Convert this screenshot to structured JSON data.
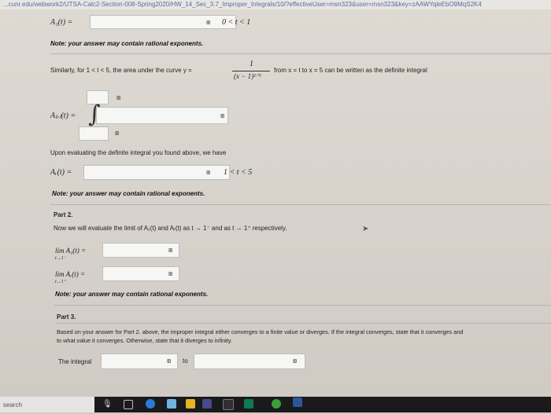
{
  "url": "...cunr.edu/webwork2/UTSA-Calc2-Section-008-Spring2020/HW_14_Sec_3.7_Improper_Integrals/10/?effectiveUser=msn323&user=msn323&key=zAAWYqleEbO9MqS2K4",
  "part1": {
    "a1_label": "A₁(t) =",
    "a1_cond": "0 < t < 1",
    "note1": "Note: your answer may contain rational exponents.",
    "similarly_pre": "Similarly, for 1 < t < 5, the area under the curve y =",
    "fraction_num": "1",
    "fraction_den": "(x − 1)²ᐟ³",
    "similarly_post": "from x = t to x = 5 can be written as the definite integral",
    "ar_label": "A₍ᵣ₎(t) =",
    "integral_sign": "∫",
    "evaluating_text": "Upon evaluating the definite integral you found above, we have",
    "ar_label2": "Aᵣ(t) =",
    "ar_cond": "1 < t < 5",
    "note2": "Note: your answer may contain rational exponents."
  },
  "part2": {
    "heading": "Part 2.",
    "intro": "Now we will evaluate the limit of A₁(t) and Aᵣ(t) as t → 1⁻ and as t → 1⁺ respectively.",
    "lim1_text": "lim  A₁(t) =",
    "lim1_sub": "t→1⁻",
    "lim2_text": "lim  Aᵣ(t) =",
    "lim2_sub": "t→1⁺",
    "note3": "Note: your answer may contain rational exponents."
  },
  "part3": {
    "heading": "Part 3.",
    "line1": "Based on your answer for Part 2. above, the improper integral either converges to a finite value or diverges. If the integral converges, state that it converges and",
    "line2": "to what value it converges. Otherwise, state that it diverges to infinity.",
    "the_integral": "The integral",
    "to_label": "to"
  },
  "matrix_glyph": "⊞",
  "taskbar": {
    "search_label": "search"
  },
  "colors": {
    "page_bg": "#dedad3",
    "taskbar_bg": "#1a1a1d",
    "input_bg": "#f6f6f4"
  }
}
